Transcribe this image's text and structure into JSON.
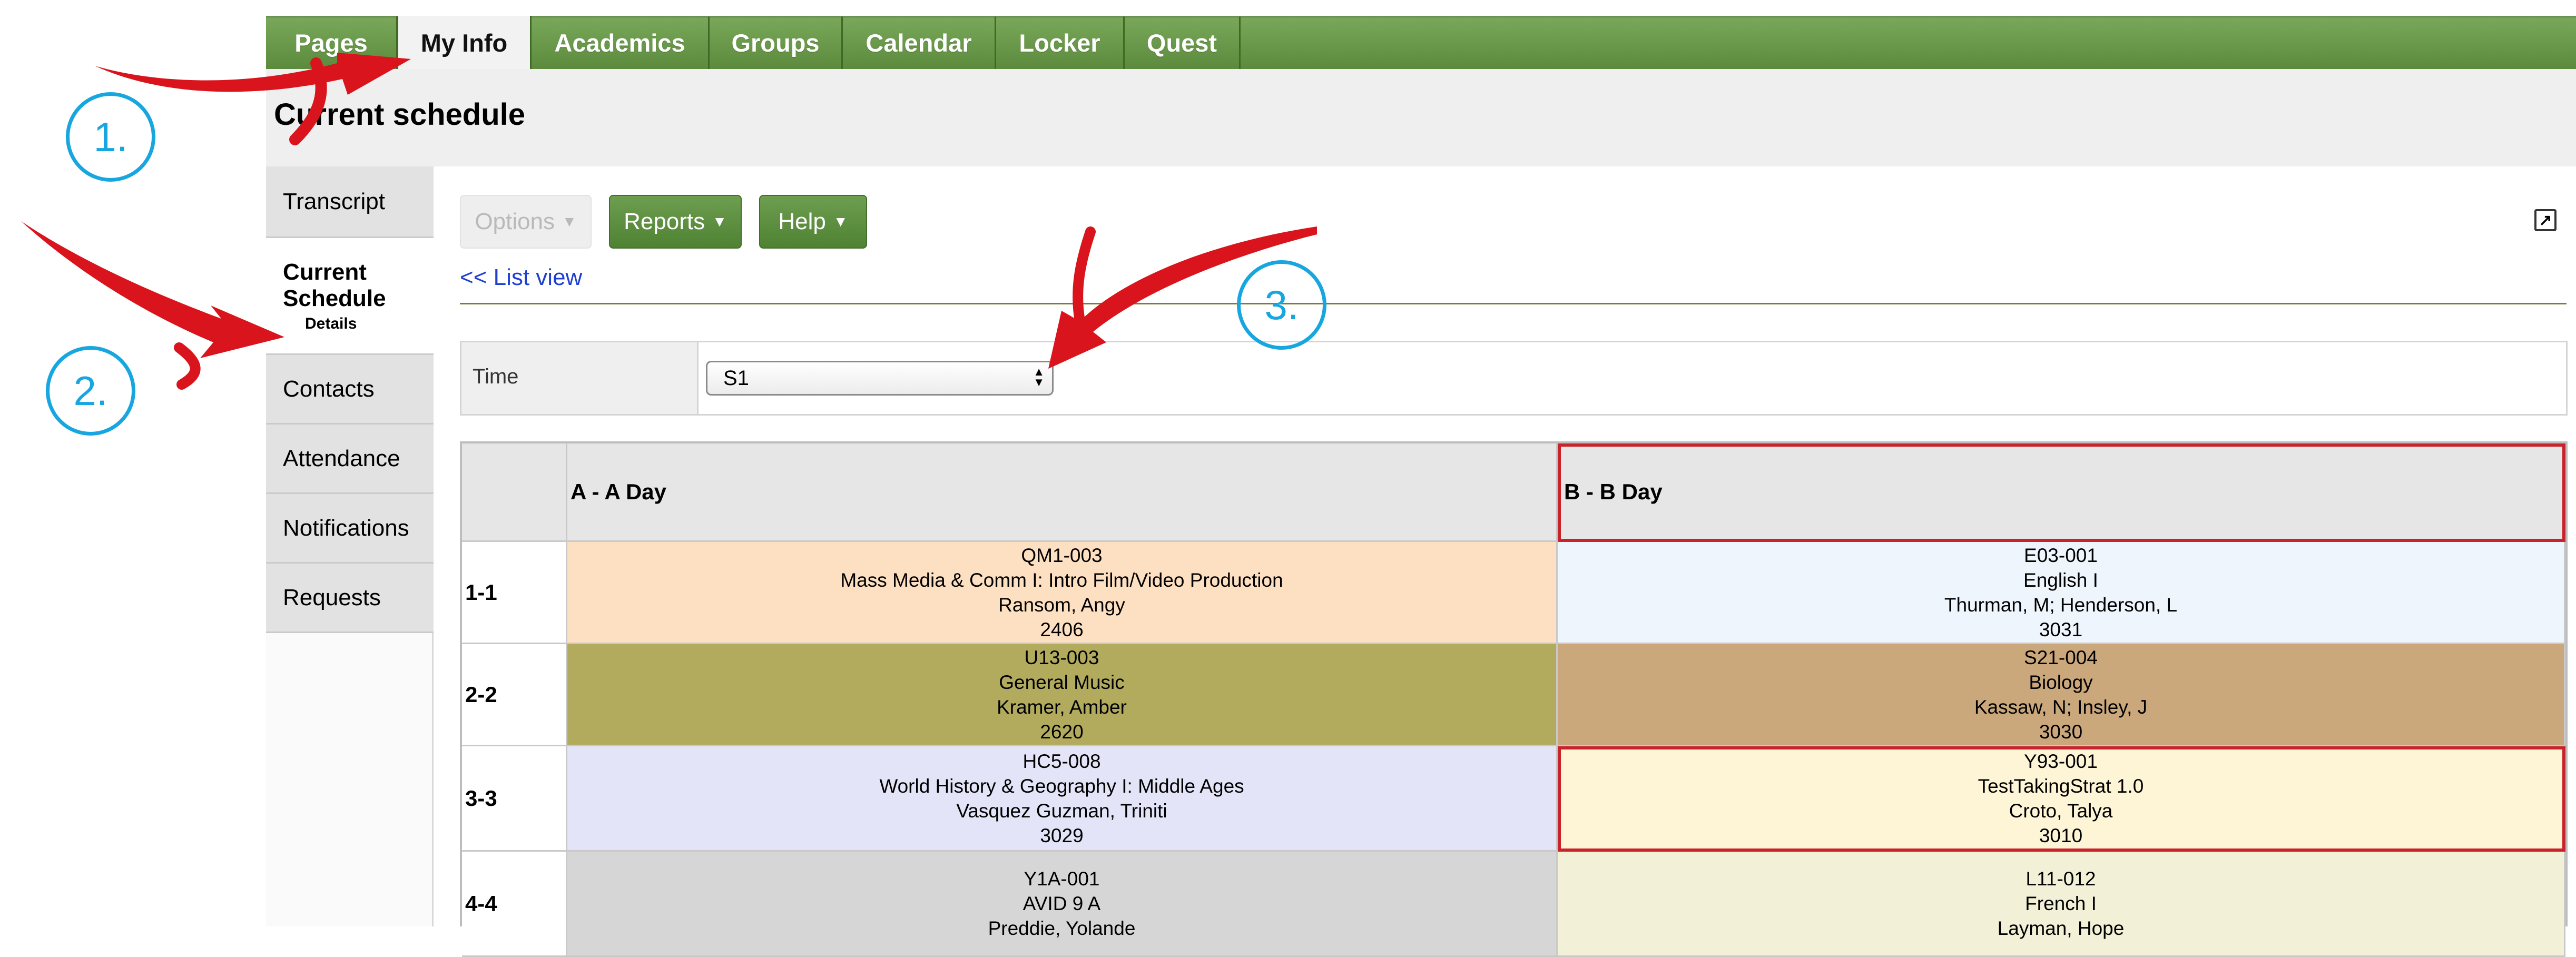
{
  "nav": {
    "tabs": [
      {
        "label": "Pages"
      },
      {
        "label": "My Info"
      },
      {
        "label": "Academics"
      },
      {
        "label": "Groups"
      },
      {
        "label": "Calendar"
      },
      {
        "label": "Locker"
      },
      {
        "label": "Quest"
      }
    ],
    "active_tab": "My Info"
  },
  "page_title": "Current schedule",
  "sidebar": {
    "items": [
      {
        "label": "Transcript"
      },
      {
        "label": "Current Schedule",
        "sub": "Details"
      },
      {
        "label": "Contacts"
      },
      {
        "label": "Attendance"
      },
      {
        "label": "Notifications"
      },
      {
        "label": "Requests"
      }
    ],
    "active_item": "Current Schedule"
  },
  "toolbar": {
    "options_label": "Options",
    "reports_label": "Reports",
    "help_label": "Help",
    "popout_icon": "popout-icon"
  },
  "list_view_link": "<< List view",
  "filter": {
    "time_label": "Time",
    "time_value": "S1"
  },
  "schedule": {
    "columns": [
      "A - A Day",
      "B - B Day"
    ],
    "rows": [
      {
        "period": "1-1",
        "a": {
          "code": "QM1-003",
          "course": "Mass Media & Comm I: Intro Film/Video Production",
          "teacher": "Ransom, Angy",
          "room": "2406",
          "color": "#fde0c2"
        },
        "b": {
          "code": "E03-001",
          "course": "English I",
          "teacher": "Thurman, M; Henderson, L",
          "room": "3031",
          "color": "#eef5fd"
        }
      },
      {
        "period": "2-2",
        "a": {
          "code": "U13-003",
          "course": "General Music",
          "teacher": "Kramer, Amber",
          "room": "2620",
          "color": "#b2ab5e"
        },
        "b": {
          "code": "S21-004",
          "course": "Biology",
          "teacher": "Kassaw, N; Insley, J",
          "room": "3030",
          "color": "#cba77c"
        }
      },
      {
        "period": "3-3",
        "a": {
          "code": "HC5-008",
          "course": "World History & Geography I: Middle Ages",
          "teacher": "Vasquez Guzman, Triniti",
          "room": "3029",
          "color": "#e3e4f7"
        },
        "b": {
          "code": "Y93-001",
          "course": "TestTakingStrat 1.0",
          "teacher": "Croto, Talya",
          "room": "3010",
          "color": "#fdf5d6"
        }
      },
      {
        "period": "4-4",
        "a": {
          "code": "Y1A-001",
          "course": "AVID 9 A",
          "teacher": "Preddie, Yolande",
          "room": "",
          "color": "#d6d6d6"
        },
        "b": {
          "code": "L11-012",
          "course": "French I",
          "teacher": "Layman, Hope",
          "room": "",
          "color": "#f2f0d6"
        }
      }
    ]
  },
  "annotations": [
    {
      "label": "1."
    },
    {
      "label": "2."
    },
    {
      "label": "3."
    }
  ],
  "colors": {
    "annotation_blue": "#17a6e0",
    "arrow_red": "#d9141c",
    "nav_green": "#5b8a3c",
    "selection_red": "#c8222a"
  }
}
